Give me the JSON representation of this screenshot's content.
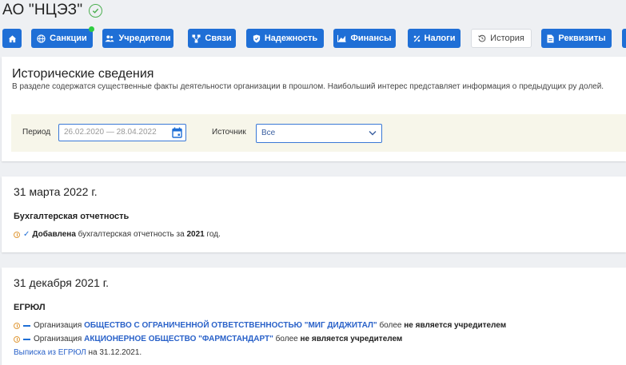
{
  "company": {
    "name": "АО \"НЦЭЗ\""
  },
  "nav": [
    {
      "label": "",
      "icon": "home-icon"
    },
    {
      "label": "Санкции",
      "icon": "globe-icon",
      "badge": true
    },
    {
      "label": "Учредители",
      "icon": "users-icon"
    },
    {
      "label": "Связи",
      "icon": "network-icon"
    },
    {
      "label": "Надежность",
      "icon": "shield-icon"
    },
    {
      "label": "Финансы",
      "icon": "chart-icon"
    },
    {
      "label": "Налоги",
      "icon": "percent-icon"
    },
    {
      "label": "История",
      "icon": "history-icon",
      "active": true
    },
    {
      "label": "Реквизиты",
      "icon": "document-icon"
    },
    {
      "label": "",
      "icon": "more-icon"
    }
  ],
  "history": {
    "title": "Исторические сведения",
    "description": "В разделе содержатся существенные факты деятельности организации в прошлом. Наибольший интерес представляет информация о предыдущих ру долей.",
    "filter": {
      "period_label": "Период",
      "period_value": "26.02.2020 — 28.04.2022",
      "source_label": "Источник",
      "source_value": "Все"
    }
  },
  "events": [
    {
      "date": "31 марта 2022 г.",
      "section": "Бухгалтерская отчетность",
      "lines": [
        {
          "bold": "Добавлена",
          "text": " бухгалтерская отчетность за ",
          "year": "2021",
          "tail": " год."
        }
      ]
    },
    {
      "date": "31 декабря 2021 г.",
      "section": "ЕГРЮЛ",
      "lines": [
        {
          "prefix": "Организация ",
          "org": "ОБЩЕСТВО С ОГРАНИЧЕННОЙ ОТВЕТСТВЕННОСТЬЮ \"МИГ ДИДЖИТАЛ\"",
          "mid": " более ",
          "bold": "не является учредителем"
        },
        {
          "prefix": "Организация ",
          "org": "АКЦИОНЕРНОЕ ОБЩЕСТВО \"ФАРМСТАНДАРТ\"",
          "mid": " более ",
          "bold": "не является учредителем"
        }
      ],
      "extract_link": "Выписка из ЕГРЮЛ",
      "extract_date": " на 31.12.2021."
    }
  ],
  "colors": {
    "primary": "#1f6fd6",
    "link": "#2a62c9",
    "filter_bg": "#f7f6ea",
    "verified": "#4caf50",
    "badge": "#2ecc40",
    "warn": "#e09a3a"
  }
}
